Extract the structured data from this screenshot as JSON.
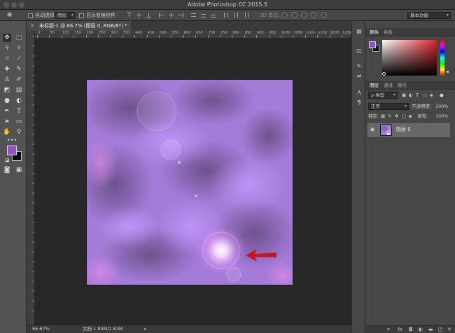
{
  "app": {
    "window_title": "Adobe Photoshop CC 2015.5"
  },
  "options_bar": {
    "auto_select_label": "自动选择:",
    "auto_select_value": "图层",
    "show_transform_label": "显示变换控件",
    "mode_3d_label": "3D 模式:",
    "workspace_value": "基本功能"
  },
  "document_tab": {
    "title": "未标题-1 @ 66.7% (图层 0, RGB/8*) *",
    "close_glyph": "×"
  },
  "ruler": {
    "h_ticks": [
      "0",
      "50",
      "100",
      "150",
      "200",
      "250",
      "300",
      "350",
      "400",
      "450",
      "500",
      "550",
      "600",
      "650",
      "700",
      "750",
      "800",
      "850",
      "900",
      "950",
      "1000",
      "1050",
      "1100",
      "1150",
      "1200",
      "1250"
    ]
  },
  "status_bar": {
    "zoom": "66.67%",
    "doc_info": "文档:1.83M/1.83M"
  },
  "color_panel": {
    "tabs": [
      "颜色",
      "色板"
    ],
    "foreground_color": "#9150c8",
    "background_color": "#111111"
  },
  "layers_panel": {
    "tabs": [
      "图层",
      "通道",
      "路径"
    ],
    "filter_label": "ρ 类型",
    "blend_mode": "正常",
    "opacity_label": "不透明度:",
    "opacity_value": "100%",
    "lock_label": "锁定:",
    "fill_label": "填充:",
    "fill_value": "100%",
    "layers": [
      {
        "name": "图层 0",
        "visible": true
      }
    ],
    "bottom_icons": [
      "link-icon",
      "fx-icon",
      "mask-icon",
      "adjustment-icon",
      "group-icon",
      "new-layer-icon",
      "trash-icon"
    ]
  },
  "canvas": {
    "annotation_arrow_color": "#c4161c",
    "accent_color": "#9150c8"
  },
  "tools": [
    "move-tool",
    "marquee-tool",
    "lasso-tool",
    "magic-wand-tool",
    "crop-tool",
    "eyedropper-tool",
    "healing-tool",
    "brush-tool",
    "clone-stamp-tool",
    "history-brush-tool",
    "eraser-tool",
    "gradient-tool",
    "blur-tool",
    "dodge-tool",
    "pen-tool",
    "type-tool",
    "path-select-tool",
    "shape-tool",
    "hand-tool",
    "zoom-tool"
  ]
}
